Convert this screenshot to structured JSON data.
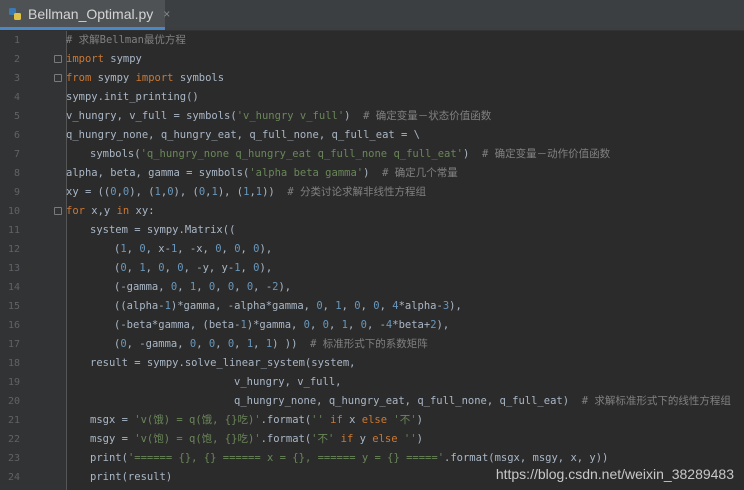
{
  "tab": {
    "filename": "Bellman_Optimal.py",
    "close_glyph": "×",
    "icon": "python-file-icon"
  },
  "code_lines": [
    {
      "n": "1",
      "indent": 0,
      "tokens": [
        {
          "t": "# 求解Bellman最优方程",
          "c": "cmt"
        }
      ]
    },
    {
      "n": "2",
      "indent": 0,
      "fold": true,
      "tokens": [
        {
          "t": "import",
          "c": "kw"
        },
        {
          "t": " sympy",
          "c": ""
        }
      ]
    },
    {
      "n": "3",
      "indent": 0,
      "fold": true,
      "tokens": [
        {
          "t": "from",
          "c": "kw"
        },
        {
          "t": " sympy ",
          "c": ""
        },
        {
          "t": "import",
          "c": "kw"
        },
        {
          "t": " symbols",
          "c": ""
        }
      ]
    },
    {
      "n": "4",
      "indent": 0,
      "tokens": [
        {
          "t": "sympy.init_printing()",
          "c": ""
        }
      ]
    },
    {
      "n": "5",
      "indent": 0,
      "tokens": [
        {
          "t": "v_hungry, v_full = symbols(",
          "c": ""
        },
        {
          "t": "'v_hungry v_full'",
          "c": "str"
        },
        {
          "t": ")",
          "c": ""
        },
        {
          "t": "  # 确定变量－状态价值函数",
          "c": "cmt"
        }
      ]
    },
    {
      "n": "6",
      "indent": 0,
      "tokens": [
        {
          "t": "q_hungry_none, q_hungry_eat, q_full_none, q_full_eat = \\",
          "c": ""
        }
      ]
    },
    {
      "n": "7",
      "indent": 1,
      "tokens": [
        {
          "t": "symbols(",
          "c": ""
        },
        {
          "t": "'q_hungry_none q_hungry_eat q_full_none q_full_eat'",
          "c": "str"
        },
        {
          "t": ")",
          "c": ""
        },
        {
          "t": "  # 确定变量－动作价值函数",
          "c": "cmt"
        }
      ]
    },
    {
      "n": "8",
      "indent": 0,
      "tokens": [
        {
          "t": "alpha, beta, gamma = symbols(",
          "c": ""
        },
        {
          "t": "'alpha beta gamma'",
          "c": "str"
        },
        {
          "t": ")",
          "c": ""
        },
        {
          "t": "  # 确定几个常量",
          "c": "cmt"
        }
      ]
    },
    {
      "n": "9",
      "indent": 0,
      "tokens": [
        {
          "t": "xy = ((",
          "c": ""
        },
        {
          "t": "0",
          "c": "num"
        },
        {
          "t": ",",
          "c": ""
        },
        {
          "t": "0",
          "c": "num"
        },
        {
          "t": "), (",
          "c": ""
        },
        {
          "t": "1",
          "c": "num"
        },
        {
          "t": ",",
          "c": ""
        },
        {
          "t": "0",
          "c": "num"
        },
        {
          "t": "), (",
          "c": ""
        },
        {
          "t": "0",
          "c": "num"
        },
        {
          "t": ",",
          "c": ""
        },
        {
          "t": "1",
          "c": "num"
        },
        {
          "t": "), (",
          "c": ""
        },
        {
          "t": "1",
          "c": "num"
        },
        {
          "t": ",",
          "c": ""
        },
        {
          "t": "1",
          "c": "num"
        },
        {
          "t": "))",
          "c": ""
        },
        {
          "t": "  # 分类讨论求解非线性方程组",
          "c": "cmt"
        }
      ]
    },
    {
      "n": "10",
      "indent": 0,
      "fold": true,
      "tokens": [
        {
          "t": "for",
          "c": "kw"
        },
        {
          "t": " x,y ",
          "c": ""
        },
        {
          "t": "in",
          "c": "kw"
        },
        {
          "t": " xy:",
          "c": ""
        }
      ]
    },
    {
      "n": "11",
      "indent": 1,
      "tokens": [
        {
          "t": "system = sympy.Matrix((",
          "c": ""
        }
      ]
    },
    {
      "n": "12",
      "indent": 2,
      "tokens": [
        {
          "t": "(",
          "c": ""
        },
        {
          "t": "1",
          "c": "num"
        },
        {
          "t": ", ",
          "c": ""
        },
        {
          "t": "0",
          "c": "num"
        },
        {
          "t": ", x-",
          "c": ""
        },
        {
          "t": "1",
          "c": "num"
        },
        {
          "t": ", -x, ",
          "c": ""
        },
        {
          "t": "0",
          "c": "num"
        },
        {
          "t": ", ",
          "c": ""
        },
        {
          "t": "0",
          "c": "num"
        },
        {
          "t": ", ",
          "c": ""
        },
        {
          "t": "0",
          "c": "num"
        },
        {
          "t": "),",
          "c": ""
        }
      ]
    },
    {
      "n": "13",
      "indent": 2,
      "tokens": [
        {
          "t": "(",
          "c": ""
        },
        {
          "t": "0",
          "c": "num"
        },
        {
          "t": ", ",
          "c": ""
        },
        {
          "t": "1",
          "c": "num"
        },
        {
          "t": ", ",
          "c": ""
        },
        {
          "t": "0",
          "c": "num"
        },
        {
          "t": ", ",
          "c": ""
        },
        {
          "t": "0",
          "c": "num"
        },
        {
          "t": ", -y, y-",
          "c": ""
        },
        {
          "t": "1",
          "c": "num"
        },
        {
          "t": ", ",
          "c": ""
        },
        {
          "t": "0",
          "c": "num"
        },
        {
          "t": "),",
          "c": ""
        }
      ]
    },
    {
      "n": "14",
      "indent": 2,
      "tokens": [
        {
          "t": "(-gamma, ",
          "c": ""
        },
        {
          "t": "0",
          "c": "num"
        },
        {
          "t": ", ",
          "c": ""
        },
        {
          "t": "1",
          "c": "num"
        },
        {
          "t": ", ",
          "c": ""
        },
        {
          "t": "0",
          "c": "num"
        },
        {
          "t": ", ",
          "c": ""
        },
        {
          "t": "0",
          "c": "num"
        },
        {
          "t": ", ",
          "c": ""
        },
        {
          "t": "0",
          "c": "num"
        },
        {
          "t": ", -",
          "c": ""
        },
        {
          "t": "2",
          "c": "num"
        },
        {
          "t": "),",
          "c": ""
        }
      ]
    },
    {
      "n": "15",
      "indent": 2,
      "tokens": [
        {
          "t": "((alpha-",
          "c": ""
        },
        {
          "t": "1",
          "c": "num"
        },
        {
          "t": ")*gamma, -alpha*gamma, ",
          "c": ""
        },
        {
          "t": "0",
          "c": "num"
        },
        {
          "t": ", ",
          "c": ""
        },
        {
          "t": "1",
          "c": "num"
        },
        {
          "t": ", ",
          "c": ""
        },
        {
          "t": "0",
          "c": "num"
        },
        {
          "t": ", ",
          "c": ""
        },
        {
          "t": "0",
          "c": "num"
        },
        {
          "t": ", ",
          "c": ""
        },
        {
          "t": "4",
          "c": "num"
        },
        {
          "t": "*alpha-",
          "c": ""
        },
        {
          "t": "3",
          "c": "num"
        },
        {
          "t": "),",
          "c": ""
        }
      ]
    },
    {
      "n": "16",
      "indent": 2,
      "tokens": [
        {
          "t": "(-beta*gamma, (beta-",
          "c": ""
        },
        {
          "t": "1",
          "c": "num"
        },
        {
          "t": ")*gamma, ",
          "c": ""
        },
        {
          "t": "0",
          "c": "num"
        },
        {
          "t": ", ",
          "c": ""
        },
        {
          "t": "0",
          "c": "num"
        },
        {
          "t": ", ",
          "c": ""
        },
        {
          "t": "1",
          "c": "num"
        },
        {
          "t": ", ",
          "c": ""
        },
        {
          "t": "0",
          "c": "num"
        },
        {
          "t": ", -",
          "c": ""
        },
        {
          "t": "4",
          "c": "num"
        },
        {
          "t": "*beta+",
          "c": ""
        },
        {
          "t": "2",
          "c": "num"
        },
        {
          "t": "),",
          "c": ""
        }
      ]
    },
    {
      "n": "17",
      "indent": 2,
      "tokens": [
        {
          "t": "(",
          "c": ""
        },
        {
          "t": "0",
          "c": "num"
        },
        {
          "t": ", -gamma, ",
          "c": ""
        },
        {
          "t": "0",
          "c": "num"
        },
        {
          "t": ", ",
          "c": ""
        },
        {
          "t": "0",
          "c": "num"
        },
        {
          "t": ", ",
          "c": ""
        },
        {
          "t": "0",
          "c": "num"
        },
        {
          "t": ", ",
          "c": ""
        },
        {
          "t": "1",
          "c": "num"
        },
        {
          "t": ", ",
          "c": ""
        },
        {
          "t": "1",
          "c": "num"
        },
        {
          "t": ") ))",
          "c": ""
        },
        {
          "t": "  # 标准形式下的系数矩阵",
          "c": "cmt"
        }
      ]
    },
    {
      "n": "18",
      "indent": 1,
      "tokens": [
        {
          "t": "result = sympy.solve_linear_system(system,",
          "c": ""
        }
      ]
    },
    {
      "n": "19",
      "indent": 7,
      "tokens": [
        {
          "t": "v_hungry, v_full,",
          "c": ""
        }
      ]
    },
    {
      "n": "20",
      "indent": 7,
      "tokens": [
        {
          "t": "q_hungry_none, q_hungry_eat, q_full_none, q_full_eat)",
          "c": ""
        },
        {
          "t": "  # 求解标准形式下的线性方程组",
          "c": "cmt"
        }
      ]
    },
    {
      "n": "21",
      "indent": 1,
      "tokens": [
        {
          "t": "msgx = ",
          "c": ""
        },
        {
          "t": "'v(饿) = q(饿, {}吃)'",
          "c": "str"
        },
        {
          "t": ".format(",
          "c": ""
        },
        {
          "t": "''",
          "c": "str"
        },
        {
          "t": " ",
          "c": ""
        },
        {
          "t": "if",
          "c": "kw"
        },
        {
          "t": " x ",
          "c": ""
        },
        {
          "t": "else",
          "c": "kw"
        },
        {
          "t": " ",
          "c": ""
        },
        {
          "t": "'不'",
          "c": "str"
        },
        {
          "t": ")",
          "c": ""
        }
      ]
    },
    {
      "n": "22",
      "indent": 1,
      "tokens": [
        {
          "t": "msgy = ",
          "c": ""
        },
        {
          "t": "'v(饱) = q(饱, {}吃)'",
          "c": "str"
        },
        {
          "t": ".format(",
          "c": ""
        },
        {
          "t": "'不'",
          "c": "str"
        },
        {
          "t": " ",
          "c": ""
        },
        {
          "t": "if",
          "c": "kw"
        },
        {
          "t": " y ",
          "c": ""
        },
        {
          "t": "else",
          "c": "kw"
        },
        {
          "t": " ",
          "c": ""
        },
        {
          "t": "''",
          "c": "str"
        },
        {
          "t": ")",
          "c": ""
        }
      ]
    },
    {
      "n": "23",
      "indent": 1,
      "tokens": [
        {
          "t": "print(",
          "c": ""
        },
        {
          "t": "'====== {}, {} ====== x = {}, ====== y = {} ====='",
          "c": "str"
        },
        {
          "t": ".format(msgx, msgy, x, y))",
          "c": ""
        }
      ]
    },
    {
      "n": "24",
      "indent": 1,
      "tokens": [
        {
          "t": "print(result)",
          "c": ""
        }
      ]
    }
  ],
  "watermark": "https://blog.csdn.net/weixin_38289483",
  "colors": {
    "background": "#2b2b2b",
    "keyword": "#cc7832",
    "string": "#6a8759",
    "number": "#6897bb",
    "comment": "#808080",
    "text": "#a9b7c6"
  }
}
